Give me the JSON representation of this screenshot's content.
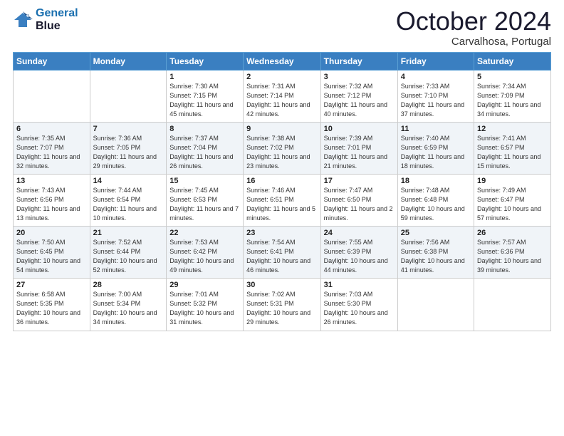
{
  "header": {
    "logo_line1": "General",
    "logo_line2": "Blue",
    "main_title": "October 2024",
    "subtitle": "Carvalhosa, Portugal"
  },
  "calendar": {
    "days_of_week": [
      "Sunday",
      "Monday",
      "Tuesday",
      "Wednesday",
      "Thursday",
      "Friday",
      "Saturday"
    ],
    "weeks": [
      [
        {
          "day": "",
          "info": ""
        },
        {
          "day": "",
          "info": ""
        },
        {
          "day": "1",
          "info": "Sunrise: 7:30 AM\nSunset: 7:15 PM\nDaylight: 11 hours and 45 minutes."
        },
        {
          "day": "2",
          "info": "Sunrise: 7:31 AM\nSunset: 7:14 PM\nDaylight: 11 hours and 42 minutes."
        },
        {
          "day": "3",
          "info": "Sunrise: 7:32 AM\nSunset: 7:12 PM\nDaylight: 11 hours and 40 minutes."
        },
        {
          "day": "4",
          "info": "Sunrise: 7:33 AM\nSunset: 7:10 PM\nDaylight: 11 hours and 37 minutes."
        },
        {
          "day": "5",
          "info": "Sunrise: 7:34 AM\nSunset: 7:09 PM\nDaylight: 11 hours and 34 minutes."
        }
      ],
      [
        {
          "day": "6",
          "info": "Sunrise: 7:35 AM\nSunset: 7:07 PM\nDaylight: 11 hours and 32 minutes."
        },
        {
          "day": "7",
          "info": "Sunrise: 7:36 AM\nSunset: 7:05 PM\nDaylight: 11 hours and 29 minutes."
        },
        {
          "day": "8",
          "info": "Sunrise: 7:37 AM\nSunset: 7:04 PM\nDaylight: 11 hours and 26 minutes."
        },
        {
          "day": "9",
          "info": "Sunrise: 7:38 AM\nSunset: 7:02 PM\nDaylight: 11 hours and 23 minutes."
        },
        {
          "day": "10",
          "info": "Sunrise: 7:39 AM\nSunset: 7:01 PM\nDaylight: 11 hours and 21 minutes."
        },
        {
          "day": "11",
          "info": "Sunrise: 7:40 AM\nSunset: 6:59 PM\nDaylight: 11 hours and 18 minutes."
        },
        {
          "day": "12",
          "info": "Sunrise: 7:41 AM\nSunset: 6:57 PM\nDaylight: 11 hours and 15 minutes."
        }
      ],
      [
        {
          "day": "13",
          "info": "Sunrise: 7:43 AM\nSunset: 6:56 PM\nDaylight: 11 hours and 13 minutes."
        },
        {
          "day": "14",
          "info": "Sunrise: 7:44 AM\nSunset: 6:54 PM\nDaylight: 11 hours and 10 minutes."
        },
        {
          "day": "15",
          "info": "Sunrise: 7:45 AM\nSunset: 6:53 PM\nDaylight: 11 hours and 7 minutes."
        },
        {
          "day": "16",
          "info": "Sunrise: 7:46 AM\nSunset: 6:51 PM\nDaylight: 11 hours and 5 minutes."
        },
        {
          "day": "17",
          "info": "Sunrise: 7:47 AM\nSunset: 6:50 PM\nDaylight: 11 hours and 2 minutes."
        },
        {
          "day": "18",
          "info": "Sunrise: 7:48 AM\nSunset: 6:48 PM\nDaylight: 10 hours and 59 minutes."
        },
        {
          "day": "19",
          "info": "Sunrise: 7:49 AM\nSunset: 6:47 PM\nDaylight: 10 hours and 57 minutes."
        }
      ],
      [
        {
          "day": "20",
          "info": "Sunrise: 7:50 AM\nSunset: 6:45 PM\nDaylight: 10 hours and 54 minutes."
        },
        {
          "day": "21",
          "info": "Sunrise: 7:52 AM\nSunset: 6:44 PM\nDaylight: 10 hours and 52 minutes."
        },
        {
          "day": "22",
          "info": "Sunrise: 7:53 AM\nSunset: 6:42 PM\nDaylight: 10 hours and 49 minutes."
        },
        {
          "day": "23",
          "info": "Sunrise: 7:54 AM\nSunset: 6:41 PM\nDaylight: 10 hours and 46 minutes."
        },
        {
          "day": "24",
          "info": "Sunrise: 7:55 AM\nSunset: 6:39 PM\nDaylight: 10 hours and 44 minutes."
        },
        {
          "day": "25",
          "info": "Sunrise: 7:56 AM\nSunset: 6:38 PM\nDaylight: 10 hours and 41 minutes."
        },
        {
          "day": "26",
          "info": "Sunrise: 7:57 AM\nSunset: 6:36 PM\nDaylight: 10 hours and 39 minutes."
        }
      ],
      [
        {
          "day": "27",
          "info": "Sunrise: 6:58 AM\nSunset: 5:35 PM\nDaylight: 10 hours and 36 minutes."
        },
        {
          "day": "28",
          "info": "Sunrise: 7:00 AM\nSunset: 5:34 PM\nDaylight: 10 hours and 34 minutes."
        },
        {
          "day": "29",
          "info": "Sunrise: 7:01 AM\nSunset: 5:32 PM\nDaylight: 10 hours and 31 minutes."
        },
        {
          "day": "30",
          "info": "Sunrise: 7:02 AM\nSunset: 5:31 PM\nDaylight: 10 hours and 29 minutes."
        },
        {
          "day": "31",
          "info": "Sunrise: 7:03 AM\nSunset: 5:30 PM\nDaylight: 10 hours and 26 minutes."
        },
        {
          "day": "",
          "info": ""
        },
        {
          "day": "",
          "info": ""
        }
      ]
    ]
  }
}
